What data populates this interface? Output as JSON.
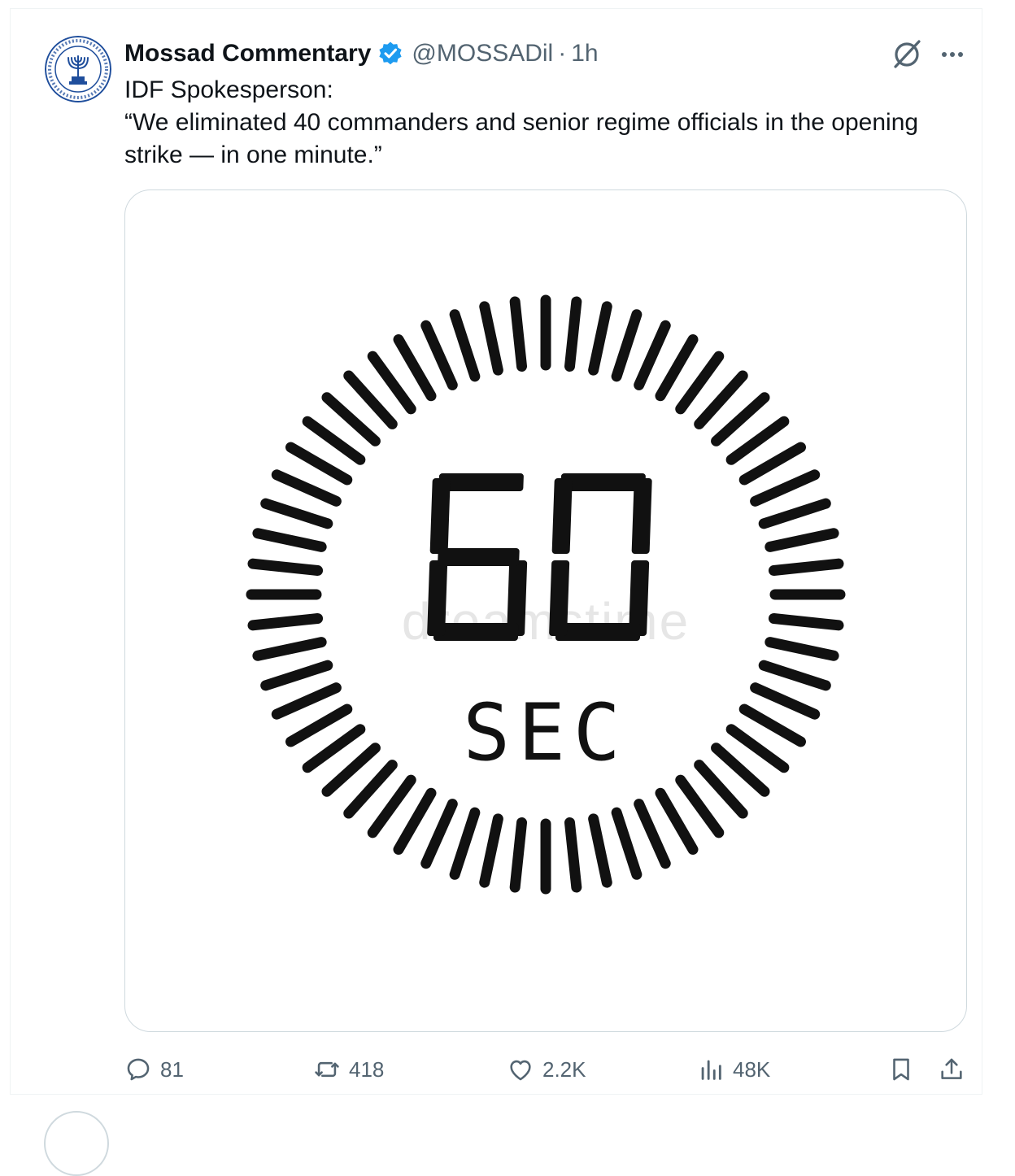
{
  "tweet": {
    "author_name": "Mossad Commentary",
    "handle": "@MOSSADil",
    "separator": "·",
    "time": "1h",
    "text_lines": [
      "IDF Spokesperson:",
      "“We eliminated 40 commanders and senior regime officials in the opening",
      "strike — in one minute.”"
    ]
  },
  "media": {
    "timer_value": "60",
    "timer_unit": "SEC",
    "watermark": "dreamstime",
    "tick_count": 60
  },
  "actions": {
    "replies": "81",
    "reposts": "418",
    "likes": "2.2K",
    "views": "48K"
  },
  "icons": {
    "verified": "verified-badge-icon",
    "grok": "grok-icon",
    "more": "more-icon",
    "reply": "reply-icon",
    "repost": "repost-icon",
    "like": "heart-icon",
    "views": "views-icon",
    "bookmark": "bookmark-icon",
    "share": "share-icon"
  },
  "colors": {
    "verified_blue": "#1d9bf0",
    "secondary_text": "#536471",
    "primary_text": "#0f1419",
    "seal_blue": "#1f4e9c"
  }
}
